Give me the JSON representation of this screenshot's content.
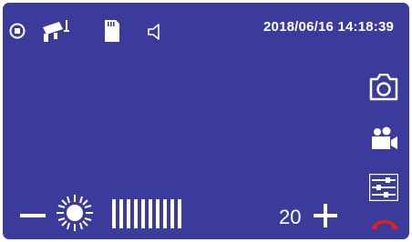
{
  "status_bar": {
    "timestamp": "2018/06/16 14:18:39",
    "icons": [
      "record-indicator-icon",
      "cctv-camera-icon",
      "sd-card-icon",
      "speaker-icon"
    ]
  },
  "side_menu": {
    "items": [
      "camera-snapshot-icon",
      "video-record-icon",
      "settings-sliders-icon",
      "hang-up-icon"
    ]
  },
  "brightness": {
    "value": "20",
    "bar_count": 10,
    "decrease_icon": "minus-icon",
    "increase_icon": "plus-icon",
    "indicator_icon": "sun-icon"
  },
  "colors": {
    "background": "#3b3b9c",
    "foreground": "#ffffff",
    "hang_up": "#e02020"
  }
}
